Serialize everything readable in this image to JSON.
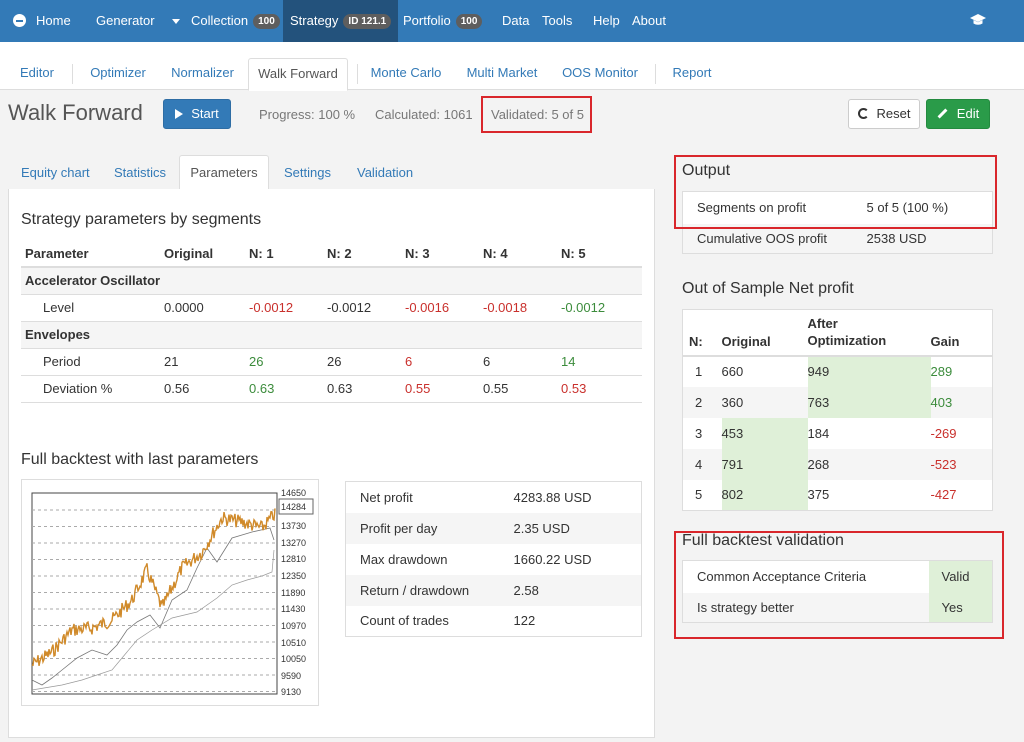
{
  "nav": {
    "home": "Home",
    "generator": "Generator",
    "collection": "Collection",
    "collection_badge": "100",
    "strategy": "Strategy",
    "strategy_badge": "ID 121.1",
    "portfolio": "Portfolio",
    "portfolio_badge": "100",
    "data": "Data",
    "tools": "Tools",
    "help": "Help",
    "about": "About"
  },
  "subnav": [
    "Editor",
    "Optimizer",
    "Normalizer",
    "Walk Forward",
    "Monte Carlo",
    "Multi Market",
    "OOS Monitor",
    "Report"
  ],
  "toolbar": {
    "title": "Walk Forward",
    "start": "Start",
    "progress": "Progress: 100 %",
    "calculated": "Calculated: 1061",
    "validated": "Validated: 5 of 5",
    "reset": "Reset",
    "edit": "Edit"
  },
  "tabs": [
    "Equity chart",
    "Statistics",
    "Parameters",
    "Settings",
    "Validation"
  ],
  "params": {
    "heading": "Strategy parameters by segments",
    "columns": [
      "Parameter",
      "Original",
      "N: 1",
      "N: 2",
      "N: 3",
      "N: 4",
      "N: 5"
    ],
    "groups": [
      {
        "name": "Accelerator Oscillator",
        "rows": [
          {
            "name": "Level",
            "values": [
              "0.0000",
              "-0.0012",
              "-0.0012",
              "-0.0016",
              "-0.0018",
              "-0.0012"
            ],
            "colors": [
              "",
              "red",
              "",
              "red",
              "red",
              "green"
            ]
          }
        ]
      },
      {
        "name": "Envelopes",
        "rows": [
          {
            "name": "Period",
            "values": [
              "21",
              "26",
              "26",
              "6",
              "6",
              "14"
            ],
            "colors": [
              "",
              "green",
              "",
              "red",
              "",
              "green"
            ]
          },
          {
            "name": "Deviation %",
            "values": [
              "0.56",
              "0.63",
              "0.63",
              "0.55",
              "0.55",
              "0.53"
            ],
            "colors": [
              "",
              "green",
              "",
              "red",
              "",
              "red"
            ]
          }
        ]
      }
    ]
  },
  "backtest": {
    "heading": "Full backtest with last parameters",
    "y_labels": [
      "14650",
      "14284",
      "13730",
      "13270",
      "12810",
      "12350",
      "11890",
      "11430",
      "10970",
      "10510",
      "10050",
      "9590",
      "9130"
    ],
    "stats": [
      {
        "label": "Net profit",
        "value": "4283.88 USD"
      },
      {
        "label": "Profit per day",
        "value": "2.35 USD"
      },
      {
        "label": "Max drawdown",
        "value": "1660.22 USD"
      },
      {
        "label": "Return / drawdown",
        "value": "2.58"
      },
      {
        "label": "Count of trades",
        "value": "122"
      }
    ]
  },
  "output": {
    "heading": "Output",
    "rows": [
      {
        "label": "Segments on profit",
        "value": "5 of 5 (100 %)"
      },
      {
        "label": "Cumulative OOS profit",
        "value": "2538 USD"
      }
    ]
  },
  "oos": {
    "heading": "Out of Sample Net profit",
    "columns": [
      "N:",
      "Original",
      "After\nOptimization",
      "Gain"
    ],
    "rows": [
      {
        "n": "1",
        "original": "660",
        "after": "949",
        "gain": "289",
        "gain_color": "green"
      },
      {
        "n": "2",
        "original": "360",
        "after": "763",
        "gain": "403",
        "gain_color": "green"
      },
      {
        "n": "3",
        "original": "453",
        "after": "184",
        "gain": "-269",
        "gain_color": "red"
      },
      {
        "n": "4",
        "original": "791",
        "after": "268",
        "gain": "-523",
        "gain_color": "red"
      },
      {
        "n": "5",
        "original": "802",
        "after": "375",
        "gain": "-427",
        "gain_color": "red"
      }
    ]
  },
  "validation": {
    "heading": "Full backtest validation",
    "rows": [
      {
        "label": "Common Acceptance Criteria",
        "value": "Valid"
      },
      {
        "label": "Is strategy better",
        "value": "Yes"
      }
    ]
  },
  "colors": {
    "nav_bg": "#337ab7",
    "nav_active": "#23527c",
    "primary": "#337ab7",
    "success": "#2a9b49",
    "highlight_green": "#dff0d8",
    "negative": "#c9302c",
    "positive": "#3c8c3c",
    "annotation": "#d9262b",
    "equity_line": "#d08a2a"
  },
  "icons": [
    "home-icon",
    "caret-down-icon",
    "graduation-cap-icon",
    "play-icon",
    "refresh-icon",
    "pencil-icon"
  ]
}
